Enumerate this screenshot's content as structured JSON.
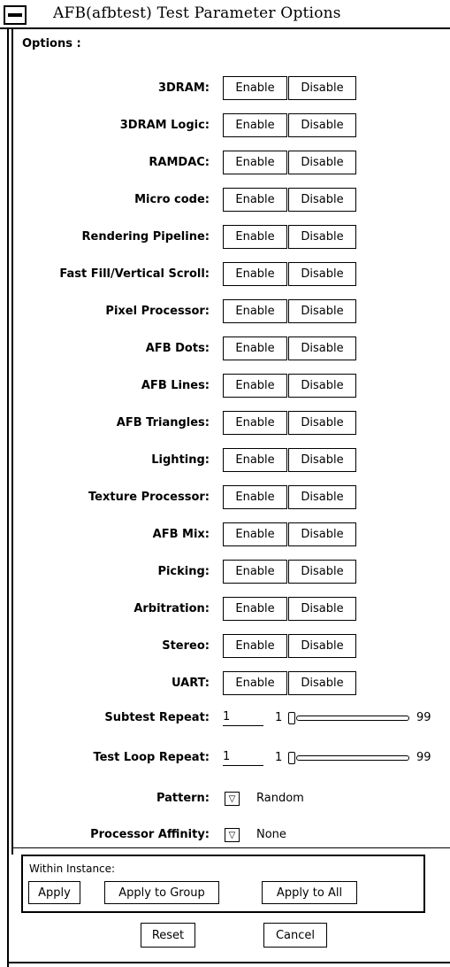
{
  "window": {
    "title": "AFB(afbtest) Test Parameter Options"
  },
  "options_label": "Options :",
  "toggles": {
    "enable_label": "Enable",
    "disable_label": "Disable",
    "rows": [
      {
        "label": "3DRAM:"
      },
      {
        "label": "3DRAM Logic:"
      },
      {
        "label": "RAMDAC:"
      },
      {
        "label": "Micro code:"
      },
      {
        "label": "Rendering Pipeline:"
      },
      {
        "label": "Fast Fill/Vertical Scroll:"
      },
      {
        "label": "Pixel Processor:"
      },
      {
        "label": "AFB Dots:"
      },
      {
        "label": "AFB Lines:"
      },
      {
        "label": "AFB Triangles:"
      },
      {
        "label": "Lighting:"
      },
      {
        "label": "Texture Processor:"
      },
      {
        "label": "AFB Mix:"
      },
      {
        "label": "Picking:"
      },
      {
        "label": "Arbitration:"
      },
      {
        "label": "Stereo:"
      },
      {
        "label": "UART:"
      }
    ]
  },
  "subtest_repeat": {
    "label": "Subtest Repeat:",
    "value": "1",
    "min": "1",
    "max": "99",
    "level": 0.0
  },
  "test_loop_repeat": {
    "label": "Test Loop Repeat:",
    "value": "1",
    "min": "1",
    "max": "99",
    "level": 0.0
  },
  "pattern": {
    "label": "Pattern:",
    "value": "Random"
  },
  "processor_affinity": {
    "label": "Processor Affinity:",
    "value": "None"
  },
  "instance_panel": {
    "label": "Within Instance:",
    "apply": "Apply",
    "apply_group": "Apply to Group",
    "apply_all": "Apply to All"
  },
  "footer": {
    "reset": "Reset",
    "cancel": "Cancel"
  }
}
